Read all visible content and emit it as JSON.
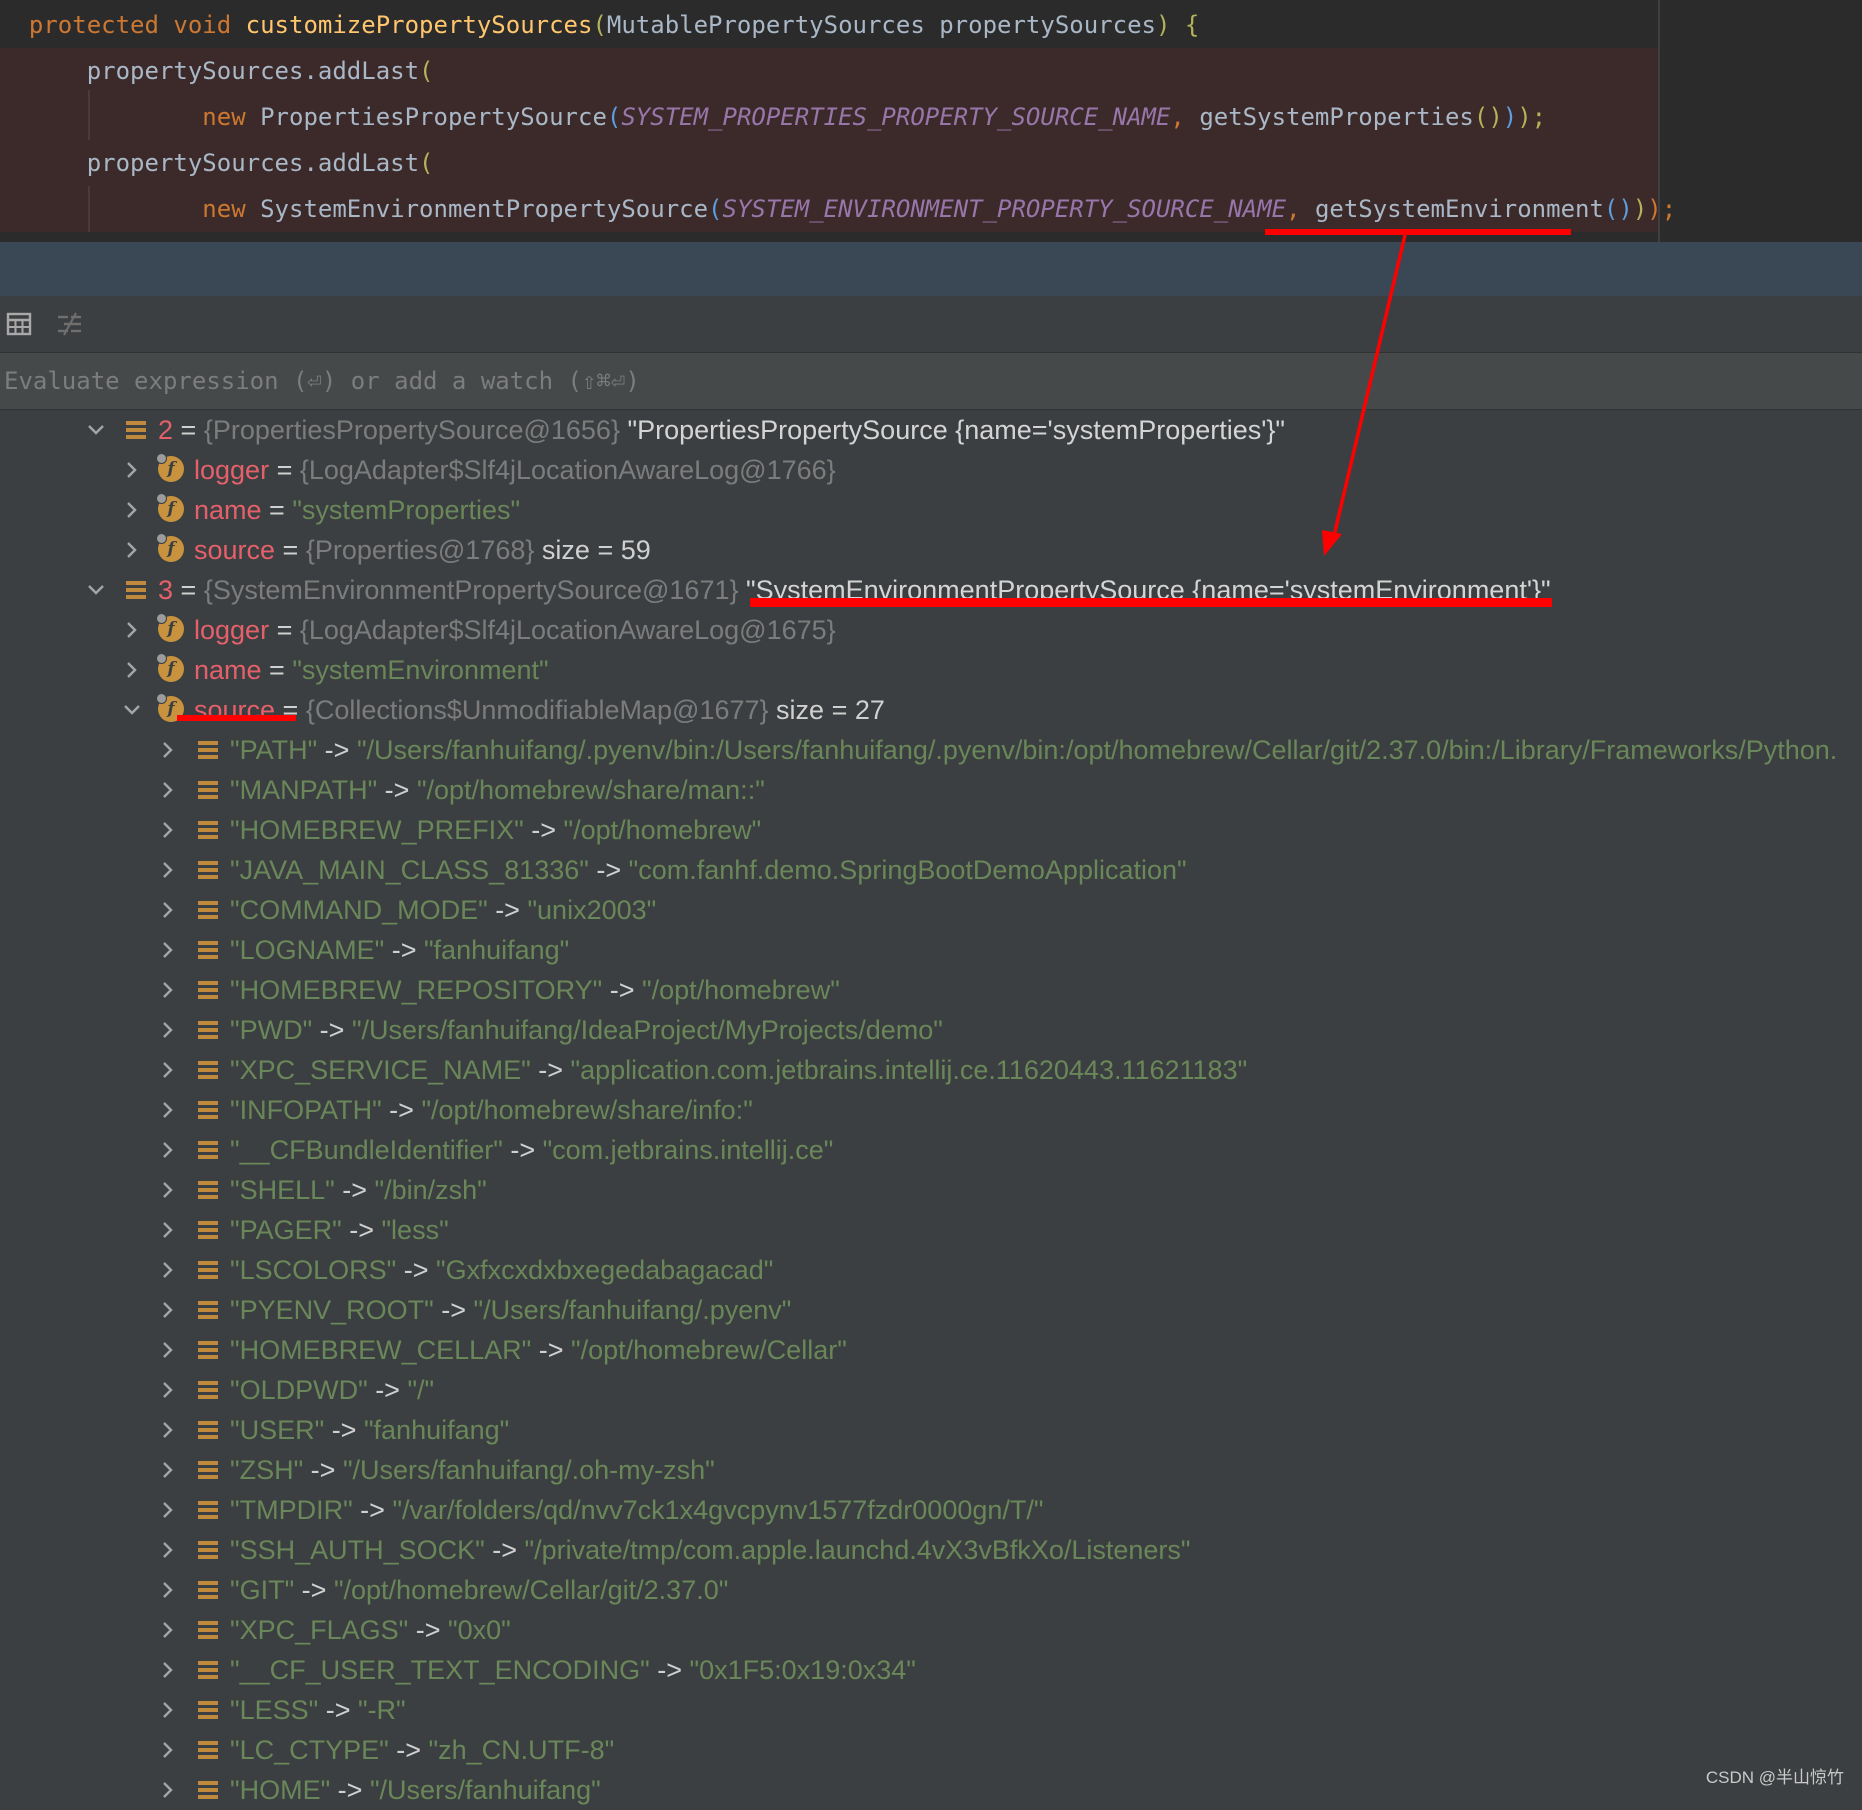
{
  "editor": {
    "line1": {
      "kw1": "protected",
      "kw2": "void",
      "fn": "customizePropertySources",
      "p_open": "(",
      "params": "MutablePropertySources propertySources",
      "p_close": ")",
      "brace": " {"
    },
    "line2": {
      "text": "propertySources.addLast",
      "paren": "("
    },
    "line3": {
      "kw": "new",
      "cls": "PropertiesPropertySource",
      "p_open": "(",
      "cst": "SYSTEM_PROPERTIES_PROPERTY_SOURCE_NAME",
      "comma": ", ",
      "call": "getSystemProperties",
      "inner": "()",
      "close": ")",
      "close2": ");"
    },
    "line4": {
      "text": "propertySources.addLast",
      "paren": "("
    },
    "line5": {
      "kw": "new",
      "cls": "SystemEnvironmentPropertySource",
      "p_open": "(",
      "cst": "SYSTEM_ENVIRONMENT_PROPERTY_SOURCE_NAME",
      "comma": ", ",
      "call": "getSystemEnvironment",
      "inner": "()",
      "close": ")",
      "close2": ");"
    }
  },
  "evaluate": {
    "placeholder": "Evaluate expression (⏎) or add a watch (⇧⌘⏎)"
  },
  "toolbar": {
    "icons": [
      "table-view-icon",
      "hide-fields-icon"
    ]
  },
  "tree": {
    "node2": {
      "index": "2",
      "eq": " = ",
      "ref": "{PropertiesPropertySource@1656}",
      "value": "\"PropertiesPropertySource {name='systemProperties'}\""
    },
    "node2_fields": [
      {
        "name": "logger",
        "eq": " = ",
        "ref": "{LogAdapter$Slf4jLocationAwareLog@1766}",
        "extra": ""
      },
      {
        "name": "name",
        "eq": " = ",
        "str": "\"systemProperties\""
      },
      {
        "name": "source",
        "eq": " = ",
        "ref": "{Properties@1768}",
        "extra": "size = 59"
      }
    ],
    "node3": {
      "index": "3",
      "eq": " = ",
      "ref": "{SystemEnvironmentPropertySource@1671}",
      "value": "\"SystemEnvironmentPropertySource {name='systemEnvironment'}\""
    },
    "node3_fields": [
      {
        "name": "logger",
        "eq": " = ",
        "ref": "{LogAdapter$Slf4jLocationAwareLog@1675}",
        "extra": ""
      },
      {
        "name": "name",
        "eq": " = ",
        "str": "\"systemEnvironment\""
      },
      {
        "name": "source",
        "eq": " = ",
        "ref": "{Collections$UnmodifiableMap@1677}",
        "extra": "size = 27"
      }
    ],
    "arrow_sep": " -> ",
    "entries": [
      {
        "key": "\"PATH\"",
        "value": "\"/Users/fanhuifang/.pyenv/bin:/Users/fanhuifang/.pyenv/bin:/opt/homebrew/Cellar/git/2.37.0/bin:/Library/Frameworks/Python."
      },
      {
        "key": "\"MANPATH\"",
        "value": "\"/opt/homebrew/share/man::\""
      },
      {
        "key": "\"HOMEBREW_PREFIX\"",
        "value": "\"/opt/homebrew\""
      },
      {
        "key": "\"JAVA_MAIN_CLASS_81336\"",
        "value": "\"com.fanhf.demo.SpringBootDemoApplication\""
      },
      {
        "key": "\"COMMAND_MODE\"",
        "value": "\"unix2003\""
      },
      {
        "key": "\"LOGNAME\"",
        "value": "\"fanhuifang\""
      },
      {
        "key": "\"HOMEBREW_REPOSITORY\"",
        "value": "\"/opt/homebrew\""
      },
      {
        "key": "\"PWD\"",
        "value": "\"/Users/fanhuifang/IdeaProject/MyProjects/demo\""
      },
      {
        "key": "\"XPC_SERVICE_NAME\"",
        "value": "\"application.com.jetbrains.intellij.ce.11620443.11621183\""
      },
      {
        "key": "\"INFOPATH\"",
        "value": "\"/opt/homebrew/share/info:\""
      },
      {
        "key": "\"__CFBundleIdentifier\"",
        "value": "\"com.jetbrains.intellij.ce\""
      },
      {
        "key": "\"SHELL\"",
        "value": "\"/bin/zsh\""
      },
      {
        "key": "\"PAGER\"",
        "value": "\"less\""
      },
      {
        "key": "\"LSCOLORS\"",
        "value": "\"Gxfxcxdxbxegedabagacad\""
      },
      {
        "key": "\"PYENV_ROOT\"",
        "value": "\"/Users/fanhuifang/.pyenv\""
      },
      {
        "key": "\"HOMEBREW_CELLAR\"",
        "value": "\"/opt/homebrew/Cellar\""
      },
      {
        "key": "\"OLDPWD\"",
        "value": "\"/\""
      },
      {
        "key": "\"USER\"",
        "value": "\"fanhuifang\""
      },
      {
        "key": "\"ZSH\"",
        "value": "\"/Users/fanhuifang/.oh-my-zsh\""
      },
      {
        "key": "\"TMPDIR\"",
        "value": "\"/var/folders/qd/nvv7ck1x4gvcpynv1577fzdr0000gn/T/\""
      },
      {
        "key": "\"SSH_AUTH_SOCK\"",
        "value": "\"/private/tmp/com.apple.launchd.4vX3vBfkXo/Listeners\""
      },
      {
        "key": "\"GIT\"",
        "value": "\"/opt/homebrew/Cellar/git/2.37.0\""
      },
      {
        "key": "\"XPC_FLAGS\"",
        "value": "\"0x0\""
      },
      {
        "key": "\"__CF_USER_TEXT_ENCODING\"",
        "value": "\"0x1F5:0x19:0x34\""
      },
      {
        "key": "\"LESS\"",
        "value": "\"-R\""
      },
      {
        "key": "\"LC_CTYPE\"",
        "value": "\"zh_CN.UTF-8\""
      },
      {
        "key": "\"HOME\"",
        "value": "\"/Users/fanhuifang\""
      }
    ]
  },
  "watermark": "CSDN @半山惊竹",
  "colors": {
    "annotation": "#ff0000",
    "field_name": "#e4606a",
    "string": "#6a8759",
    "reference": "#7c7c7c"
  }
}
